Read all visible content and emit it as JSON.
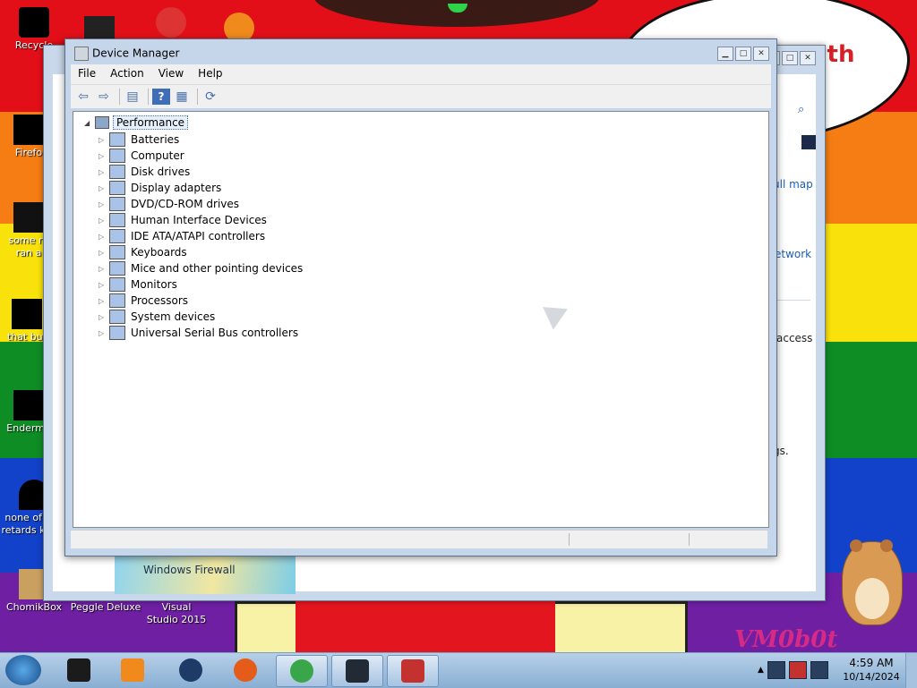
{
  "desktop": {
    "bubble_text": "nth",
    "vm_logo": "VM0b0t",
    "icons": [
      {
        "label": "Recycle",
        "icon": "recycle-bin-icon"
      },
      {
        "label": "Firefo",
        "icon": "firefox-icon"
      },
      {
        "label": "some ru ran a",
        "icon": "file-icon"
      },
      {
        "label": "that but",
        "icon": "file-icon"
      },
      {
        "label": "Enderma",
        "icon": "app-icon"
      },
      {
        "label": "none of you retards kno...",
        "icon": "app-icon"
      },
      {
        "label": "ChomikBox",
        "icon": "chomikbox-icon"
      },
      {
        "label": "Peggle Deluxe",
        "icon": "peggle-icon"
      },
      {
        "label": "Visual Studio 2015",
        "icon": "visual-studio-icon"
      }
    ]
  },
  "background_window": {
    "links": [
      "ull map",
      "etwork"
    ],
    "texts": [
      "access",
      "gs."
    ],
    "firewall_label": "Windows Firewall"
  },
  "device_manager": {
    "title": "Device Manager",
    "menu": [
      "File",
      "Action",
      "View",
      "Help"
    ],
    "toolbar": [
      {
        "name": "back-icon",
        "glyph": "⇦"
      },
      {
        "name": "forward-icon",
        "glyph": "⇨"
      },
      {
        "name": "show-hide-console-tree-icon",
        "glyph": "▤"
      },
      {
        "name": "help-icon",
        "glyph": "?"
      },
      {
        "name": "properties-icon",
        "glyph": "▦"
      },
      {
        "name": "scan-hardware-icon",
        "glyph": "⟳"
      }
    ],
    "tree": {
      "root": "Performance",
      "nodes": [
        {
          "label": "Batteries",
          "icon": "battery-icon"
        },
        {
          "label": "Computer",
          "icon": "computer-icon"
        },
        {
          "label": "Disk drives",
          "icon": "disk-drive-icon"
        },
        {
          "label": "Display adapters",
          "icon": "display-adapter-icon"
        },
        {
          "label": "DVD/CD-ROM drives",
          "icon": "dvd-drive-icon"
        },
        {
          "label": "Human Interface Devices",
          "icon": "hid-icon"
        },
        {
          "label": "IDE ATA/ATAPI controllers",
          "icon": "ide-controller-icon"
        },
        {
          "label": "Keyboards",
          "icon": "keyboard-icon"
        },
        {
          "label": "Mice and other pointing devices",
          "icon": "mouse-icon"
        },
        {
          "label": "Monitors",
          "icon": "monitor-icon"
        },
        {
          "label": "Processors",
          "icon": "processor-icon"
        },
        {
          "label": "System devices",
          "icon": "system-devices-icon"
        },
        {
          "label": "Universal Serial Bus controllers",
          "icon": "usb-icon"
        }
      ]
    }
  },
  "taskbar": {
    "tasks": [
      {
        "name": "task-terminal",
        "icon": "terminal-icon",
        "color": "#1b1b1b"
      },
      {
        "name": "task-media-player",
        "icon": "media-player-icon",
        "color": "#f08a1c"
      },
      {
        "name": "task-globe",
        "icon": "globe-icon",
        "color": "#1e3a66"
      },
      {
        "name": "task-firefox",
        "icon": "firefox-icon",
        "color": "#e55b1a"
      },
      {
        "name": "task-windows-explorer",
        "icon": "windows-icon",
        "color": "#3aa64a"
      },
      {
        "name": "task-monitor",
        "icon": "monitor-icon",
        "color": "#222a36"
      },
      {
        "name": "task-toolbox",
        "icon": "toolbox-icon",
        "color": "#c4322f"
      }
    ],
    "clock": {
      "time": "4:59 AM",
      "date": "10/14/2024"
    }
  }
}
